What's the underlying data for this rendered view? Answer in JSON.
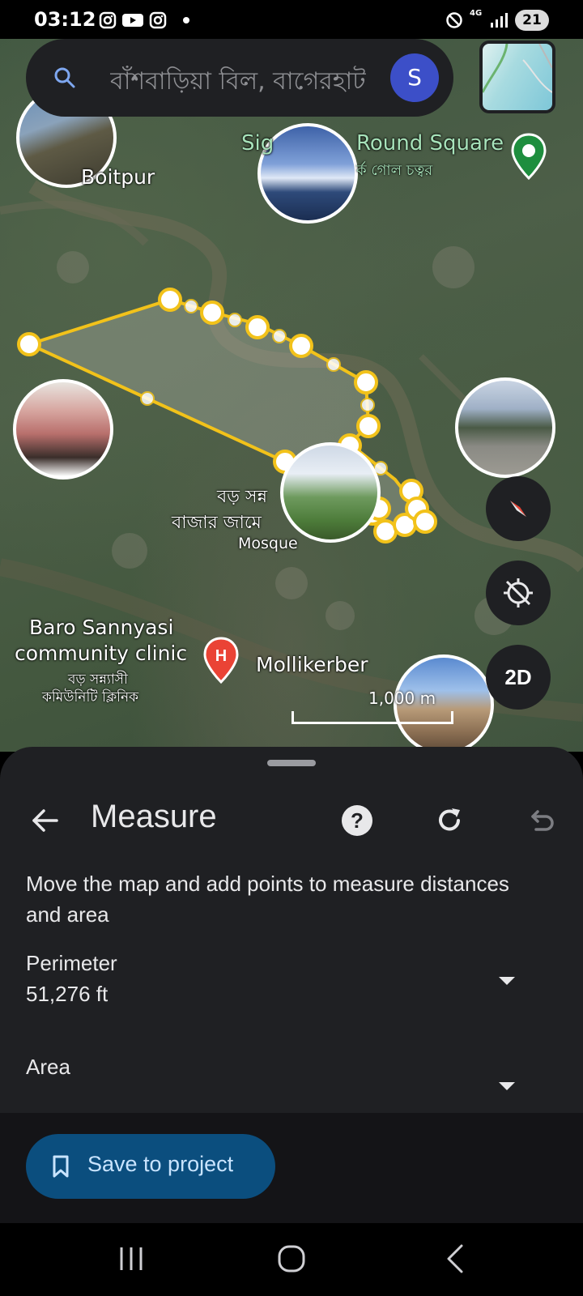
{
  "status_bar": {
    "time": "03:12",
    "network": "4G",
    "battery": "21",
    "icons": [
      "instagram-icon",
      "youtube-icon",
      "instagram-icon",
      "dnd-icon",
      "signal-icon"
    ]
  },
  "search": {
    "text": "বাঁশবাড়িয়া বিল, বাগেরহাট",
    "avatar_letter": "S"
  },
  "map": {
    "labels": {
      "boitpur": "Boitpur",
      "round_square_en": "Round Square",
      "round_square_prefix": "Sig",
      "round_square_bn": "র্ক গোল চত্বর",
      "mosque_bn_1": "বড় সন্ন",
      "mosque_bn_2": "বাজার জামে",
      "mosque_en": "Mosque",
      "clinic_en_1": "Baro Sannyasi",
      "clinic_en_2": "community clinic",
      "clinic_bn_1": "বড় সন্ন্যাসী",
      "clinic_bn_2": "কমিউনিটি ক্লিনিক",
      "mollikerber": "Mollikerber",
      "scale": "1,000 m",
      "two_d": "2D"
    },
    "colors": {
      "measure_line": "#f2c21a",
      "place_pin": "#1e8e3e",
      "hospital_pin": "#ea4335"
    }
  },
  "sheet": {
    "title": "Measure",
    "instructions": "Move the map and add points to measure distances and area",
    "perimeter_label": "Perimeter",
    "perimeter_value": "51,276 ft",
    "area_label": "Area",
    "save_label": "Save to project"
  }
}
